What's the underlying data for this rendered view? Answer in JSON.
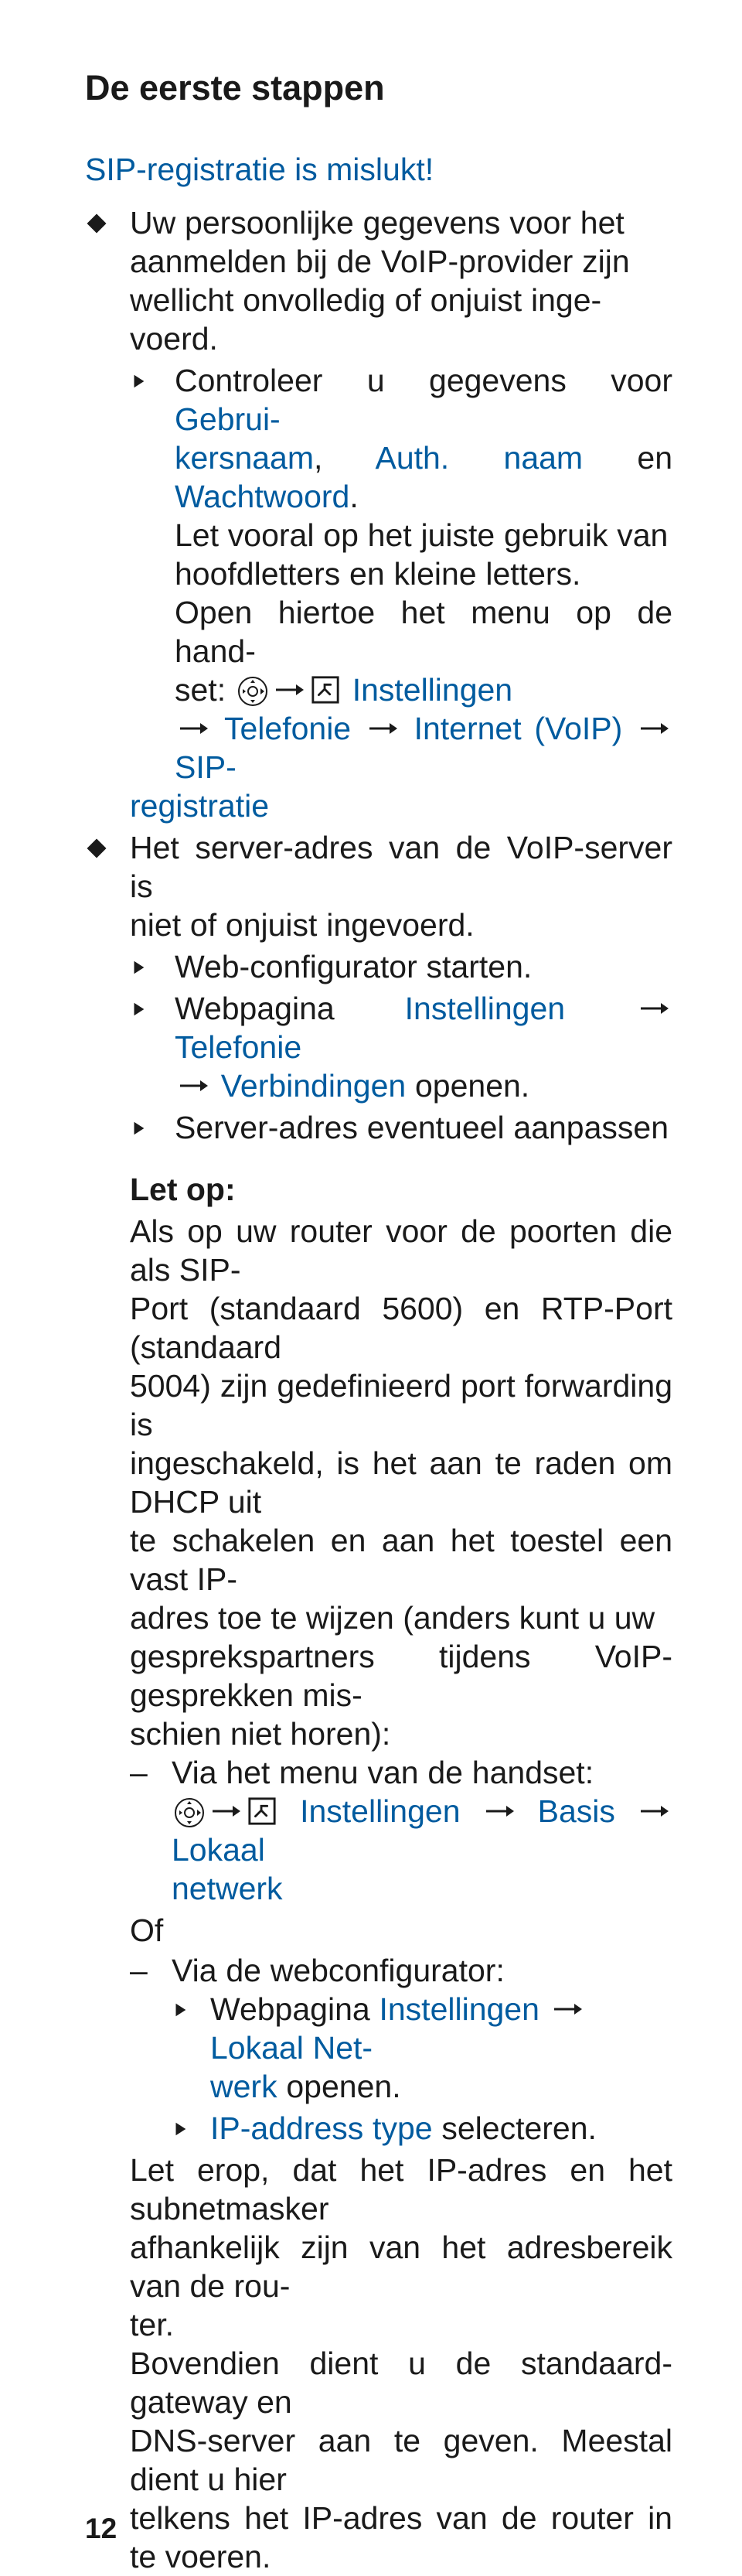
{
  "heading": "De eerste stappen",
  "subheading": "SIP-registratie is mislukt!",
  "item1_l1": "Uw persoonlijke gegevens voor het",
  "item1_l2": "aanmelden bij de VoIP-provider zijn",
  "item1_l3": "wellicht onvolledig of onjuist inge-",
  "item1_l4": "voerd.",
  "sub1a_l1": "Controleer u gegevens voor ",
  "sub1a_b1": "Gebrui-",
  "sub1a_b2": "kersnaam",
  "sub1a_c1": ", ",
  "sub1a_b3": "Auth. naam",
  "sub1a_c2": " en ",
  "sub1a_b4": "Wachtwoord",
  "sub1a_c3": ".",
  "sub1a_l3": "Let vooral op het juiste gebruik van",
  "sub1a_l4": "hoofdletters en kleine letters.",
  "sub1a_l5": "Open hiertoe het menu op de hand-",
  "sub1a_l6a": "set: ",
  "sub1a_inst": " Instellingen ",
  "sub1a_tel": " Telefonie ",
  "sub1a_int": " Internet (VoIP) ",
  "sub1a_sip1": " SIP-",
  "sub1a_sip2": "registratie",
  "item2_l1": "Het server-adres van de VoIP-server is",
  "item2_l2": "niet of onjuist ingevoerd.",
  "sub2a": "Web-configurator starten.",
  "sub2b_a": "Webpagina ",
  "sub2b_b1": "Instellingen ",
  "sub2b_b2": " Telefonie ",
  "sub2b_b3": " Verbindingen",
  "sub2b_c": " openen.",
  "sub2c": "Server-adres eventueel aanpassen",
  "notice_title": "Let op:",
  "notice_l1": "Als op uw router voor de poorten die als SIP-",
  "notice_l2": "Port (standaard 5600) en RTP-Port (standaard",
  "notice_l3": "5004) zijn gedefinieerd port forwarding is",
  "notice_l4": "ingeschakeld, is het aan te raden om DHCP uit",
  "notice_l5": "te schakelen en aan het toestel een vast IP-",
  "notice_l6": "adres toe te wijzen (anders kunt u uw",
  "notice_l7": "gesprekspartners tijdens VoIP-gesprekken mis-",
  "notice_l8": "schien niet horen):",
  "dash1": "Via het menu van de handset:",
  "dash1_inst": " Instellingen ",
  "dash1_basis": " Basis ",
  "dash1_lok": " Lokaal",
  "dash1_net": "netwerk",
  "of_label": "Of",
  "dash2": "Via de webconfigurator:",
  "dash2s1_a": "Webpagina ",
  "dash2s1_b": "Instellingen ",
  "dash2s1_c": " Lokaal Net-",
  "dash2s1_d": "werk",
  "dash2s1_e": " openen.",
  "dash2s2_a": "IP-address type",
  "dash2s2_b": " selecteren.",
  "notice2_l1": "Let erop, dat het IP-adres en het subnetmasker",
  "notice2_l2": "afhankelijk zijn van het adresbereik van de rou-",
  "notice2_l3": "ter.",
  "notice2_l4": "Bovendien dient u de standaard-gateway en",
  "notice2_l5": "DNS-server aan te geven. Meestal dient u hier",
  "notice2_l6": "telkens het IP-adres van de router in te voeren.",
  "page_num": "12"
}
